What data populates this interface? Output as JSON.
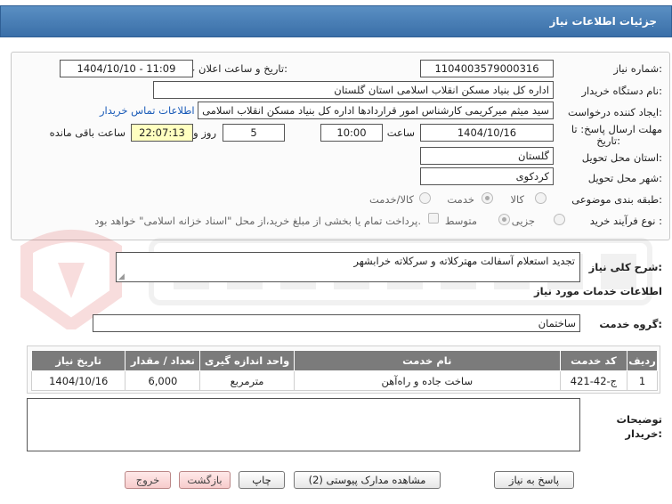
{
  "header": {
    "title": "جزئیات اطلاعات نیاز"
  },
  "form": {
    "need_number_label": "شماره نیاز:",
    "need_number": "1104003579000316",
    "announce_label": "تاریخ و ساعت اعلان عمومی:",
    "announce_value": "1404/10/10 - 11:09",
    "buyer_org_label": "نام دستگاه خریدار:",
    "buyer_org": "اداره کل بنیاد مسکن انقلاب اسلامی استان گلستان",
    "creator_label": "ایجاد کننده درخواست:",
    "creator": "سید میثم میرکریمی کارشناس امور قراردادها اداره کل بنیاد مسکن انقلاب اسلامی استان گلستان",
    "contact_link": "اطلاعات تماس خریدار",
    "deadline_label_1": "مهلت ارسال پاسخ: تا",
    "deadline_label_2": "تاریخ:",
    "deadline_date": "1404/10/16",
    "time_label": "ساعت",
    "deadline_time": "10:00",
    "days_value": "5",
    "days_label": "روز و",
    "remaining_time": "22:07:13",
    "remaining_label": "ساعت باقی مانده",
    "province_label": "استان محل تحویل:",
    "province": "گلستان",
    "city_label": "شهر محل تحویل:",
    "city": "کردکوی",
    "category_label": "طبقه بندی موضوعی:",
    "category_options": [
      "کالا",
      "خدمت",
      "کالا/خدمت"
    ],
    "process_label": "نوع فرآیند خرید :",
    "process_options": [
      "جزیی",
      "متوسط"
    ],
    "payment_note": "پرداخت تمام یا بخشی از مبلغ خرید،از محل \"اسناد خزانه اسلامی\" خواهد بود."
  },
  "description": {
    "label": "شرح کلی نیاز:",
    "value": "تجدید استعلام آسفالت مهترکلاته و سرکلاته خرابشهر"
  },
  "services": {
    "heading": "اطلاعات خدمات مورد نیاز",
    "group_label": "گروه خدمت:",
    "group_value": "ساختمان",
    "columns": [
      "ردیف",
      "کد خدمت",
      "نام خدمت",
      "واحد اندازه گیری",
      "تعداد / مقدار",
      "تاریخ نیاز"
    ],
    "rows": [
      [
        "1",
        "ج-42-421",
        "ساخت جاده و راه‌آهن",
        "مترمربع",
        "6,000",
        "1404/10/16"
      ]
    ]
  },
  "buyer_notes": {
    "label_1": "توضیحات",
    "label_2": "خریدار:"
  },
  "buttons": {
    "reply": "پاسخ به نیاز",
    "attachments": "مشاهده مدارک پیوستی (2)",
    "print": "چاپ",
    "back": "بازگشت",
    "exit": "خروج"
  },
  "colors": {
    "header": "#3a6fa8",
    "link": "#1a5bb8",
    "remaining_bg": "#ffffc0"
  }
}
